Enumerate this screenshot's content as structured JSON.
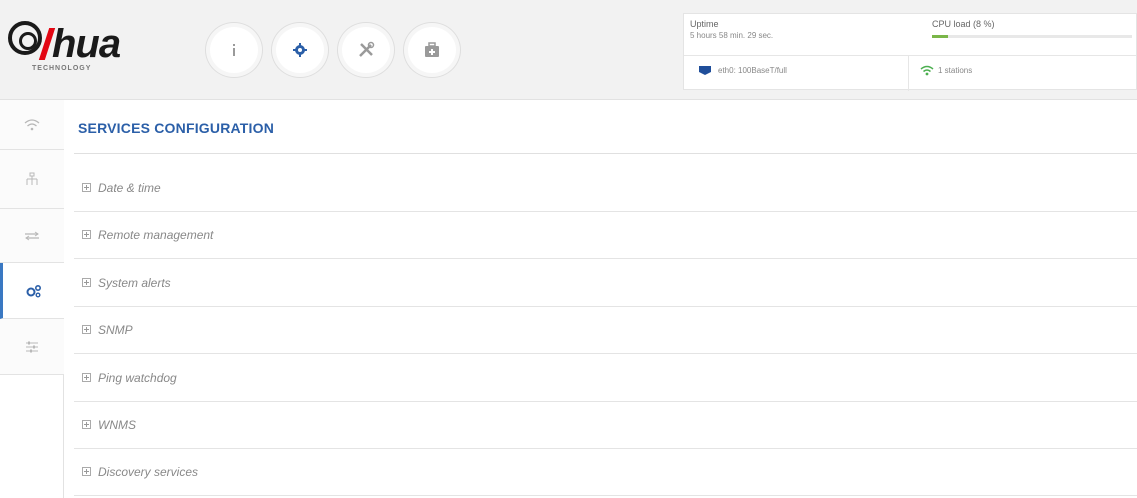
{
  "brand": {
    "logo_text": "alhua",
    "logo_subtitle": "TECHNOLOGY"
  },
  "nav": {
    "buttons": [
      {
        "icon": "info-icon"
      },
      {
        "icon": "gear-icon",
        "active": true
      },
      {
        "icon": "tools-icon"
      },
      {
        "icon": "toolbox-icon"
      }
    ]
  },
  "status": {
    "uptime_label": "Uptime",
    "uptime_value": "5 hours 58 min. 29 sec.",
    "cpu_label": "CPU load (8 %)",
    "cpu_percent": 8,
    "eth_text": "eth0: 100BaseT/full",
    "wifi_text": "1 stations"
  },
  "sidebar": {
    "items": [
      {
        "icon": "wifi-icon"
      },
      {
        "icon": "network-icon"
      },
      {
        "icon": "routing-icon"
      },
      {
        "icon": "services-icon",
        "active": true
      },
      {
        "icon": "system-icon"
      }
    ]
  },
  "main": {
    "title": "SERVICES CONFIGURATION",
    "sections": [
      {
        "label": "Date & time"
      },
      {
        "label": "Remote management"
      },
      {
        "label": "System alerts"
      },
      {
        "label": "SNMP"
      },
      {
        "label": "Ping watchdog"
      },
      {
        "label": "WNMS"
      },
      {
        "label": "Discovery services"
      }
    ]
  },
  "colors": {
    "accent": "#2b5fa8",
    "active_indicator": "#3a78c2",
    "brand_red": "#e30613",
    "wifi_green": "#4caf50",
    "ethernet_blue": "#1f4e9a"
  }
}
